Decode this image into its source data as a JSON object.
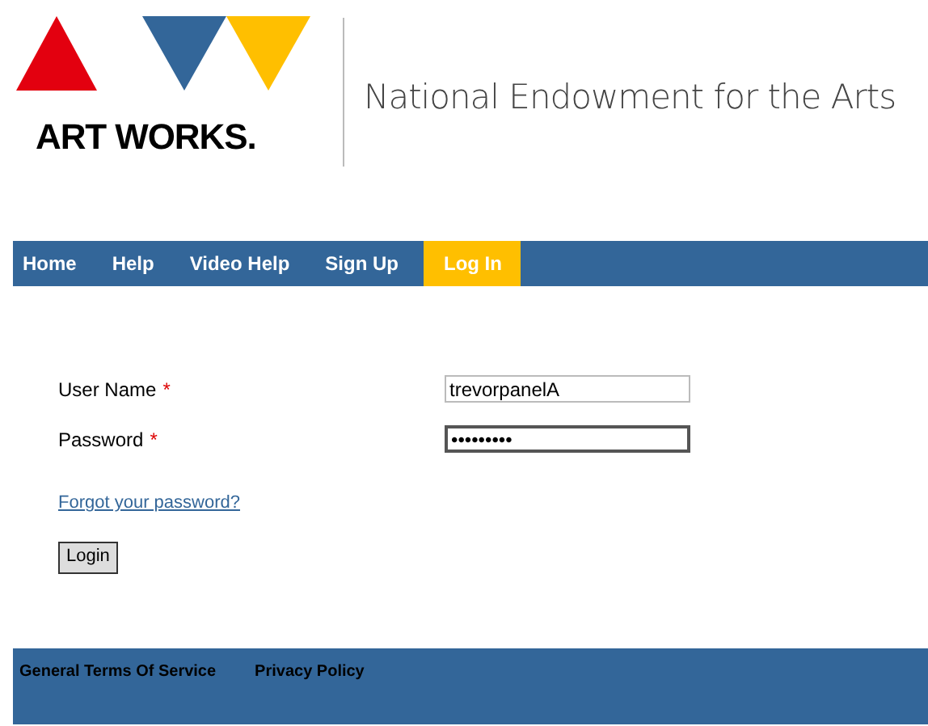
{
  "logo": {
    "wordmark": "ART WORKS.",
    "agency": "National Endowment for the Arts"
  },
  "nav": [
    {
      "label": "Home",
      "selected": false
    },
    {
      "label": "Help",
      "selected": false
    },
    {
      "label": "Video Help",
      "selected": false
    },
    {
      "label": "Sign Up",
      "selected": false
    },
    {
      "label": "Log In",
      "selected": true
    }
  ],
  "form": {
    "fields": [
      {
        "label": "User Name",
        "required": "*",
        "value": "trevorpanelA",
        "focused": false
      },
      {
        "label": "Password",
        "required": "*",
        "value": "•••••••••",
        "focused": true
      }
    ],
    "forgot_link": "Forgot your password?",
    "submit": "Login"
  },
  "footer": {
    "links": [
      "General Terms Of Service",
      "Privacy Policy"
    ]
  }
}
